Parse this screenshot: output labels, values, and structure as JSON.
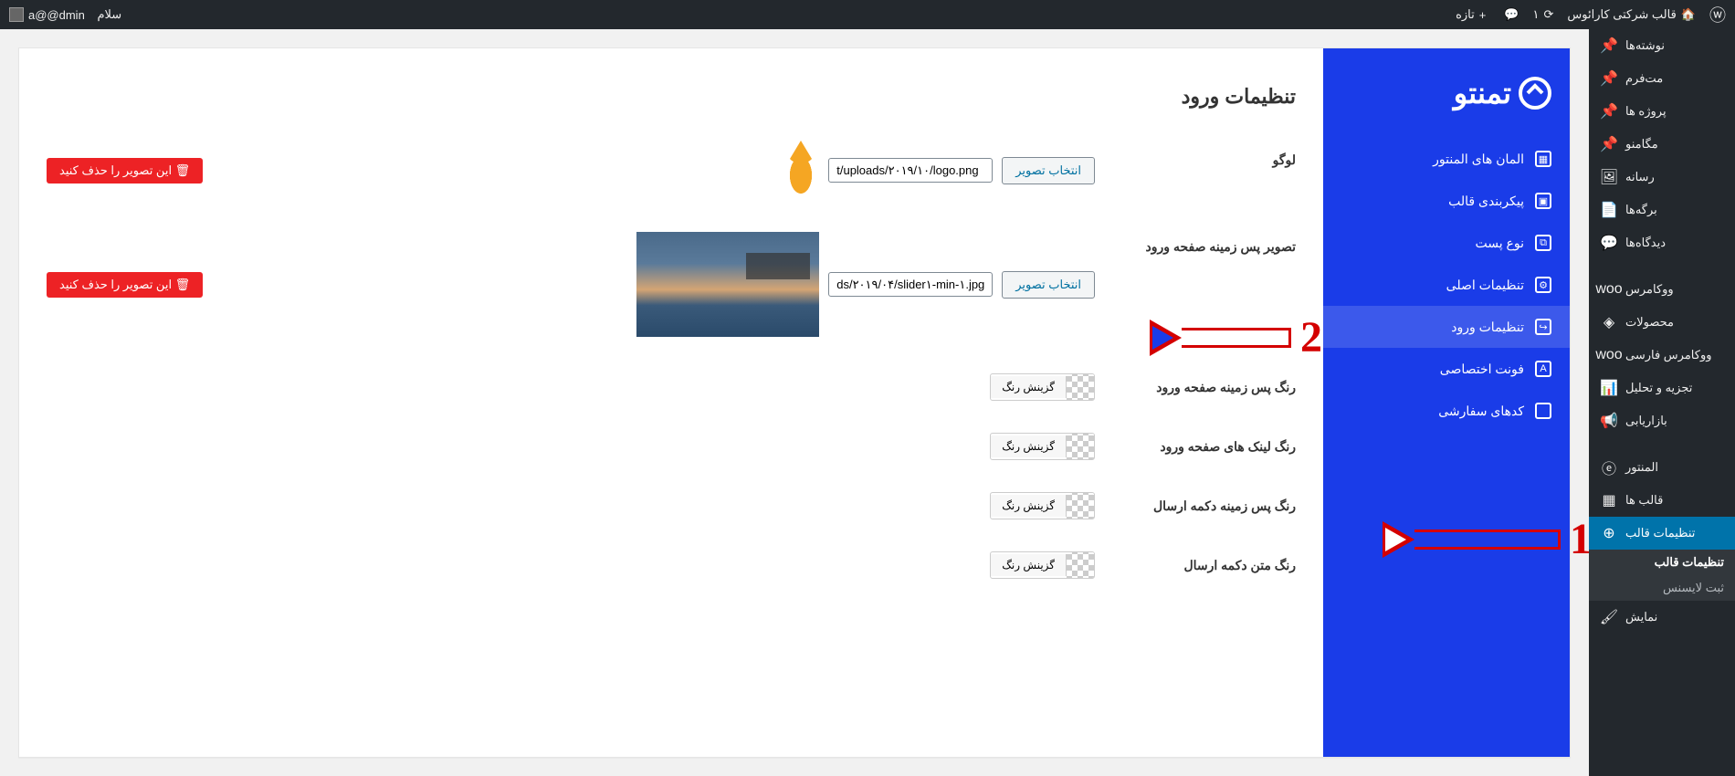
{
  "adminBar": {
    "siteName": "قالب شرکتی کارائوس",
    "updates": "۱",
    "comments": "",
    "new": "تازه",
    "greeting": "سلام",
    "user": "a@@dmin"
  },
  "wpMenu": [
    {
      "label": "نوشته‌ها",
      "icon": "📌"
    },
    {
      "label": "مت‌فرم",
      "icon": "📌"
    },
    {
      "label": "پروژه ها",
      "icon": "📌"
    },
    {
      "label": "مگامنو",
      "icon": "📌"
    },
    {
      "label": "رسانه",
      "icon": "🖼"
    },
    {
      "label": "برگه‌ها",
      "icon": "📄"
    },
    {
      "label": "دیدگاه‌ها",
      "icon": "💬"
    },
    {
      "label": "ووکامرس",
      "icon": "woo"
    },
    {
      "label": "محصولات",
      "icon": "◈"
    },
    {
      "label": "ووکامرس فارسی",
      "icon": "woo"
    },
    {
      "label": "تجزیه و تحلیل",
      "icon": "📊"
    },
    {
      "label": "بازاریابی",
      "icon": "📢"
    },
    {
      "label": "المنتور",
      "icon": "ⓔ"
    },
    {
      "label": "قالب ها",
      "icon": "▦"
    },
    {
      "label": "تنظیمات قالب",
      "icon": "⊕",
      "active": true
    },
    {
      "label": "نمایش",
      "icon": "🖌"
    }
  ],
  "wpSubmenu": [
    {
      "label": "تنظیمات قالب",
      "current": true
    },
    {
      "label": "ثبت لایسنس"
    }
  ],
  "optionsLogo": "تمنتو",
  "optionsMenu": [
    {
      "label": "المان های المنتور",
      "icon": "▦"
    },
    {
      "label": "پیکربندی قالب",
      "icon": "▣"
    },
    {
      "label": "نوع پست",
      "icon": "⧉"
    },
    {
      "label": "تنظیمات اصلی",
      "icon": "⚙"
    },
    {
      "label": "تنظیمات ورود",
      "icon": "↪",
      "active": true
    },
    {
      "label": "فونت اختصاصی",
      "icon": "A"
    },
    {
      "label": "کدهای سفارشی",
      "icon": "</>"
    }
  ],
  "pageTitle": "تنظیمات ورود",
  "fields": {
    "logo": {
      "label": "لوگو",
      "btn": "انتخاب تصویر",
      "value": "t/uploads/۲۰۱۹/۱۰/logo.png",
      "delete": "این تصویر را حذف کنید"
    },
    "bgImage": {
      "label": "تصویر پس زمینه صفحه ورود",
      "btn": "انتخاب تصویر",
      "value": "ds/۲۰۱۹/۰۴/slider۱-min-۱.jpg",
      "delete": "این تصویر را حذف کنید"
    },
    "colorBtn": "گزینش رنگ",
    "colors": [
      {
        "label": "رنگ پس زمینه صفحه ورود"
      },
      {
        "label": "رنگ لینک های صفحه ورود"
      },
      {
        "label": "رنگ پس زمینه دکمه ارسال"
      },
      {
        "label": "رنگ متن دکمه ارسال"
      }
    ]
  },
  "annotations": {
    "arrow1": "1",
    "arrow2": "2"
  }
}
